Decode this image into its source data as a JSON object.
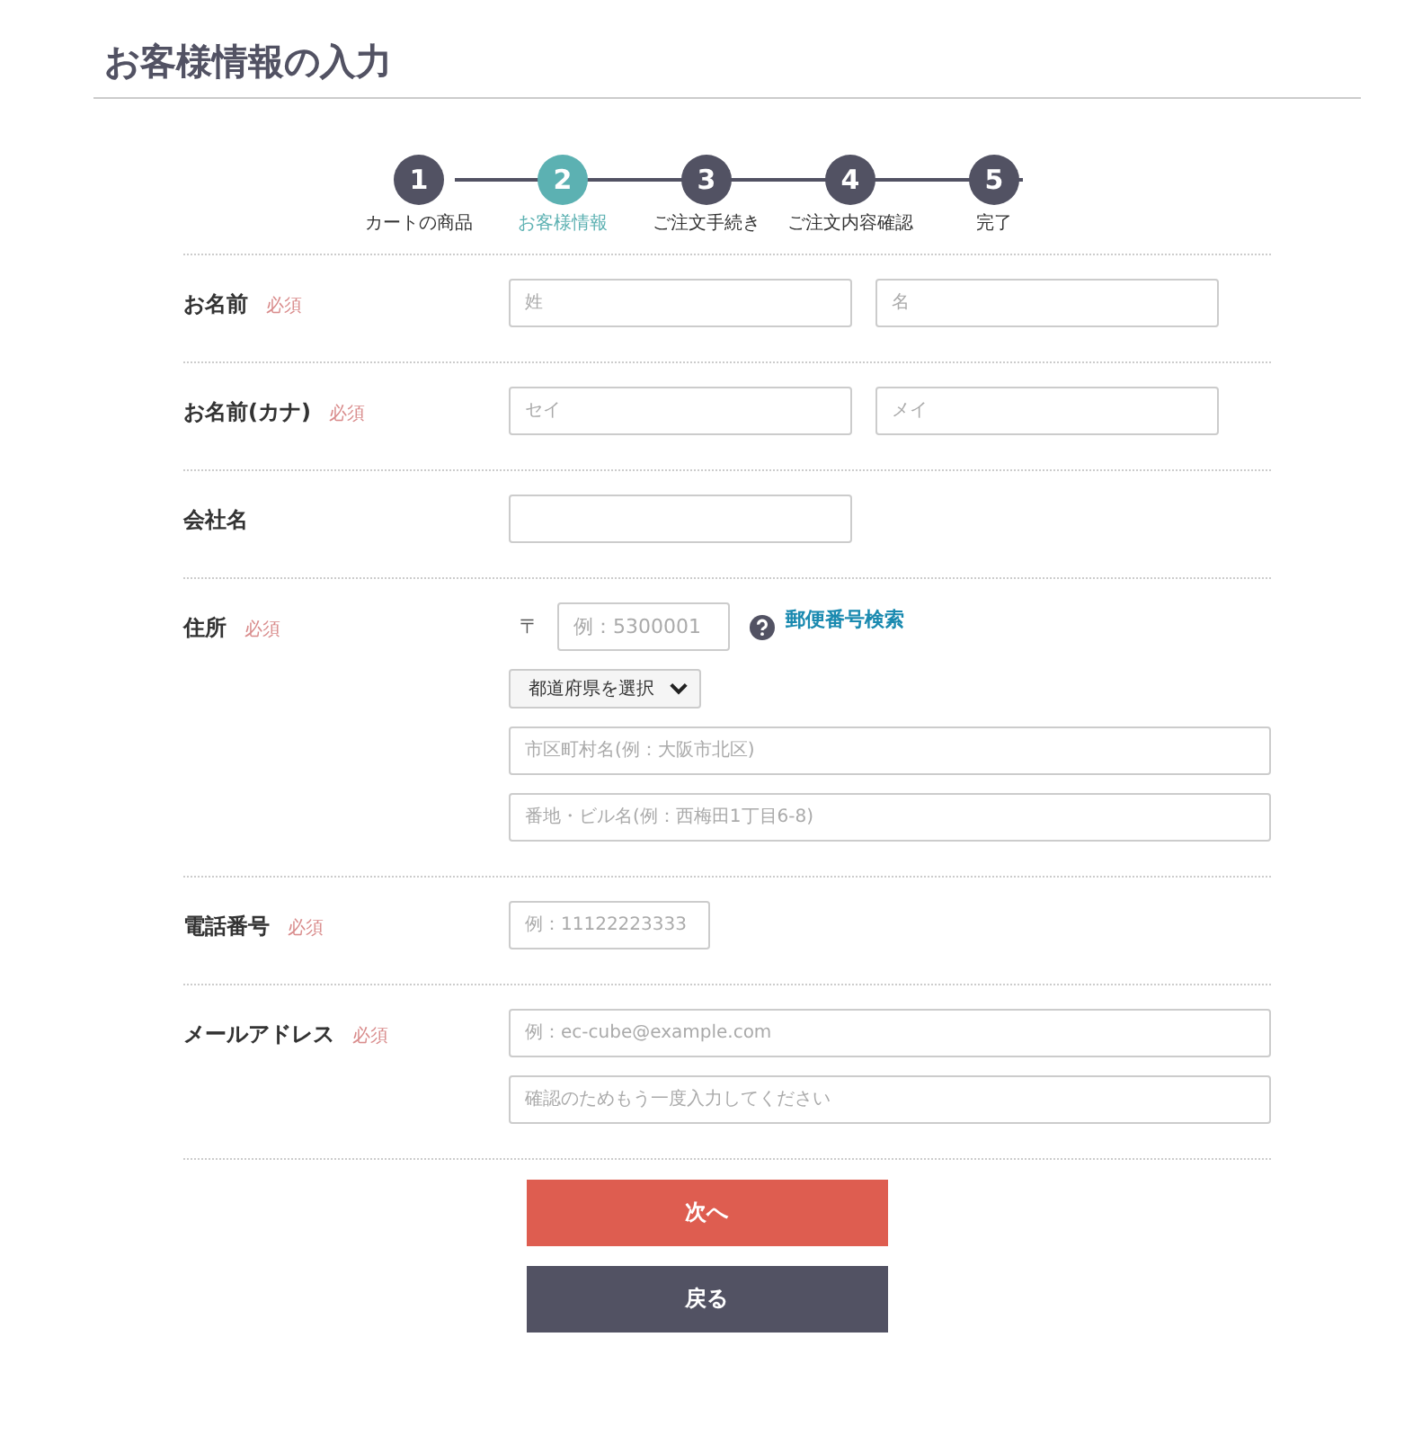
{
  "title": "お客様情報の入力",
  "steps": [
    {
      "number": "1",
      "label": "カートの商品",
      "selected": false
    },
    {
      "number": "2",
      "label": "お客様情報",
      "selected": true
    },
    {
      "number": "3",
      "label": "ご注文手続き",
      "selected": false
    },
    {
      "number": "4",
      "label": "ご注文内容確認",
      "selected": false
    },
    {
      "number": "5",
      "label": "完了",
      "selected": false
    }
  ],
  "rows": [
    {
      "label": "お名前",
      "badge": "必須",
      "lines": [
        [
          {
            "kind": "half",
            "placeholder": "姓"
          },
          {
            "kind": "half",
            "placeholder": "名"
          }
        ]
      ]
    },
    {
      "label": "お名前(カナ)",
      "badge": "必須",
      "lines": [
        [
          {
            "kind": "half",
            "placeholder": "セイ"
          },
          {
            "kind": "half",
            "placeholder": "メイ"
          }
        ]
      ]
    },
    {
      "label": "会社名",
      "lines": [
        [
          {
            "kind": "half"
          }
        ]
      ]
    },
    {
      "label": "住所",
      "badge": "必須",
      "lines": [
        [
          {
            "kind": "postal",
            "prefix": "〒",
            "placeholder": "例：5300001",
            "link": "郵便番号検索"
          }
        ],
        [
          {
            "kind": "select",
            "value": "都道府県を選択"
          }
        ],
        [
          {
            "kind": "full",
            "placeholder": "市区町村名(例：大阪市北区)"
          }
        ],
        [
          {
            "kind": "full",
            "placeholder": "番地・ビル名(例：西梅田1丁目6-8)"
          }
        ]
      ]
    },
    {
      "label": "電話番号",
      "badge": "必須",
      "lines": [
        [
          {
            "kind": "short",
            "placeholder": "例：11122223333"
          }
        ]
      ]
    },
    {
      "label": "メールアドレス",
      "badge": "必須",
      "lines": [
        [
          {
            "kind": "full",
            "placeholder": "例：ec-cube@example.com"
          }
        ],
        [
          {
            "kind": "full",
            "placeholder": "確認のためもう一度入力してください"
          }
        ]
      ]
    }
  ],
  "buttons": [
    {
      "label": "次へ",
      "kind": "primary"
    },
    {
      "label": "戻る",
      "kind": "secondary"
    }
  ]
}
